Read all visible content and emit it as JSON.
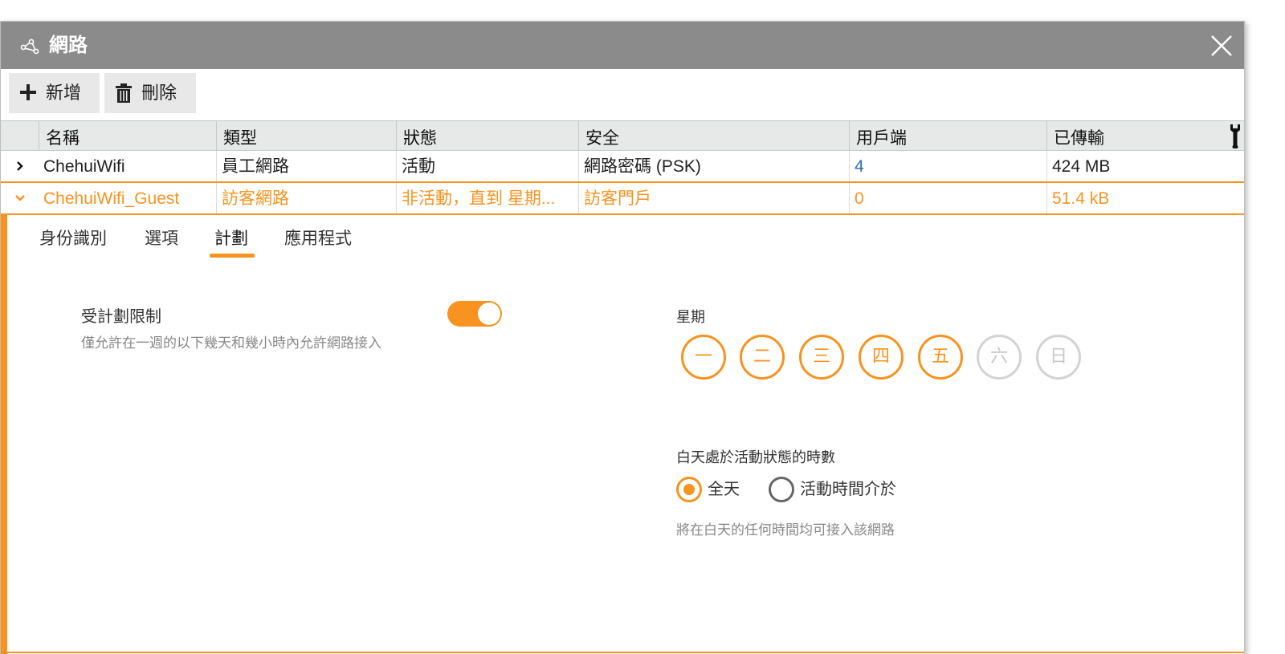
{
  "window": {
    "title": "網路"
  },
  "toolbar": {
    "add_label": "新增",
    "delete_label": "刪除"
  },
  "table": {
    "columns": [
      "名稱",
      "類型",
      "狀態",
      "安全",
      "用戶端",
      "已傳輸"
    ],
    "rows": [
      {
        "name": "ChehuiWifi",
        "type": "員工網路",
        "status": "活動",
        "security": "網路密碼 (PSK)",
        "clients": "4",
        "transferred": "424 MB",
        "expanded": false
      },
      {
        "name": "ChehuiWifi_Guest",
        "type": "訪客網路",
        "status": "非活動，直到 星期...",
        "security": "訪客門戶",
        "clients": "0",
        "transferred": "51.4 kB",
        "expanded": true
      }
    ]
  },
  "detail": {
    "tabs": [
      "身份識別",
      "選項",
      "計劃",
      "應用程式"
    ],
    "active_tab": "計劃",
    "schedule_label": "受計劃限制",
    "schedule_desc": "僅允許在一週的以下幾天和幾小時內允許網路接入",
    "schedule_enabled": true,
    "week_label": "星期",
    "days": [
      {
        "label": "一",
        "selected": true
      },
      {
        "label": "二",
        "selected": true
      },
      {
        "label": "三",
        "selected": true
      },
      {
        "label": "四",
        "selected": true
      },
      {
        "label": "五",
        "selected": true
      },
      {
        "label": "六",
        "selected": false
      },
      {
        "label": "日",
        "selected": false
      }
    ],
    "hours_label": "白天處於活動狀態的時數",
    "option_allday": "全天",
    "option_between": "活動時間介於",
    "selected_option": "全天",
    "hours_desc": "將在白天的任何時間均可接入該網路"
  },
  "colors": {
    "accent": "#f7931e",
    "titlebar": "#8a8b8a",
    "link": "#2a6fb8"
  },
  "icons": {
    "title": "network-icon",
    "close": "close-icon",
    "add": "plus-icon",
    "delete": "trash-icon",
    "columns": "wrench-icon"
  }
}
